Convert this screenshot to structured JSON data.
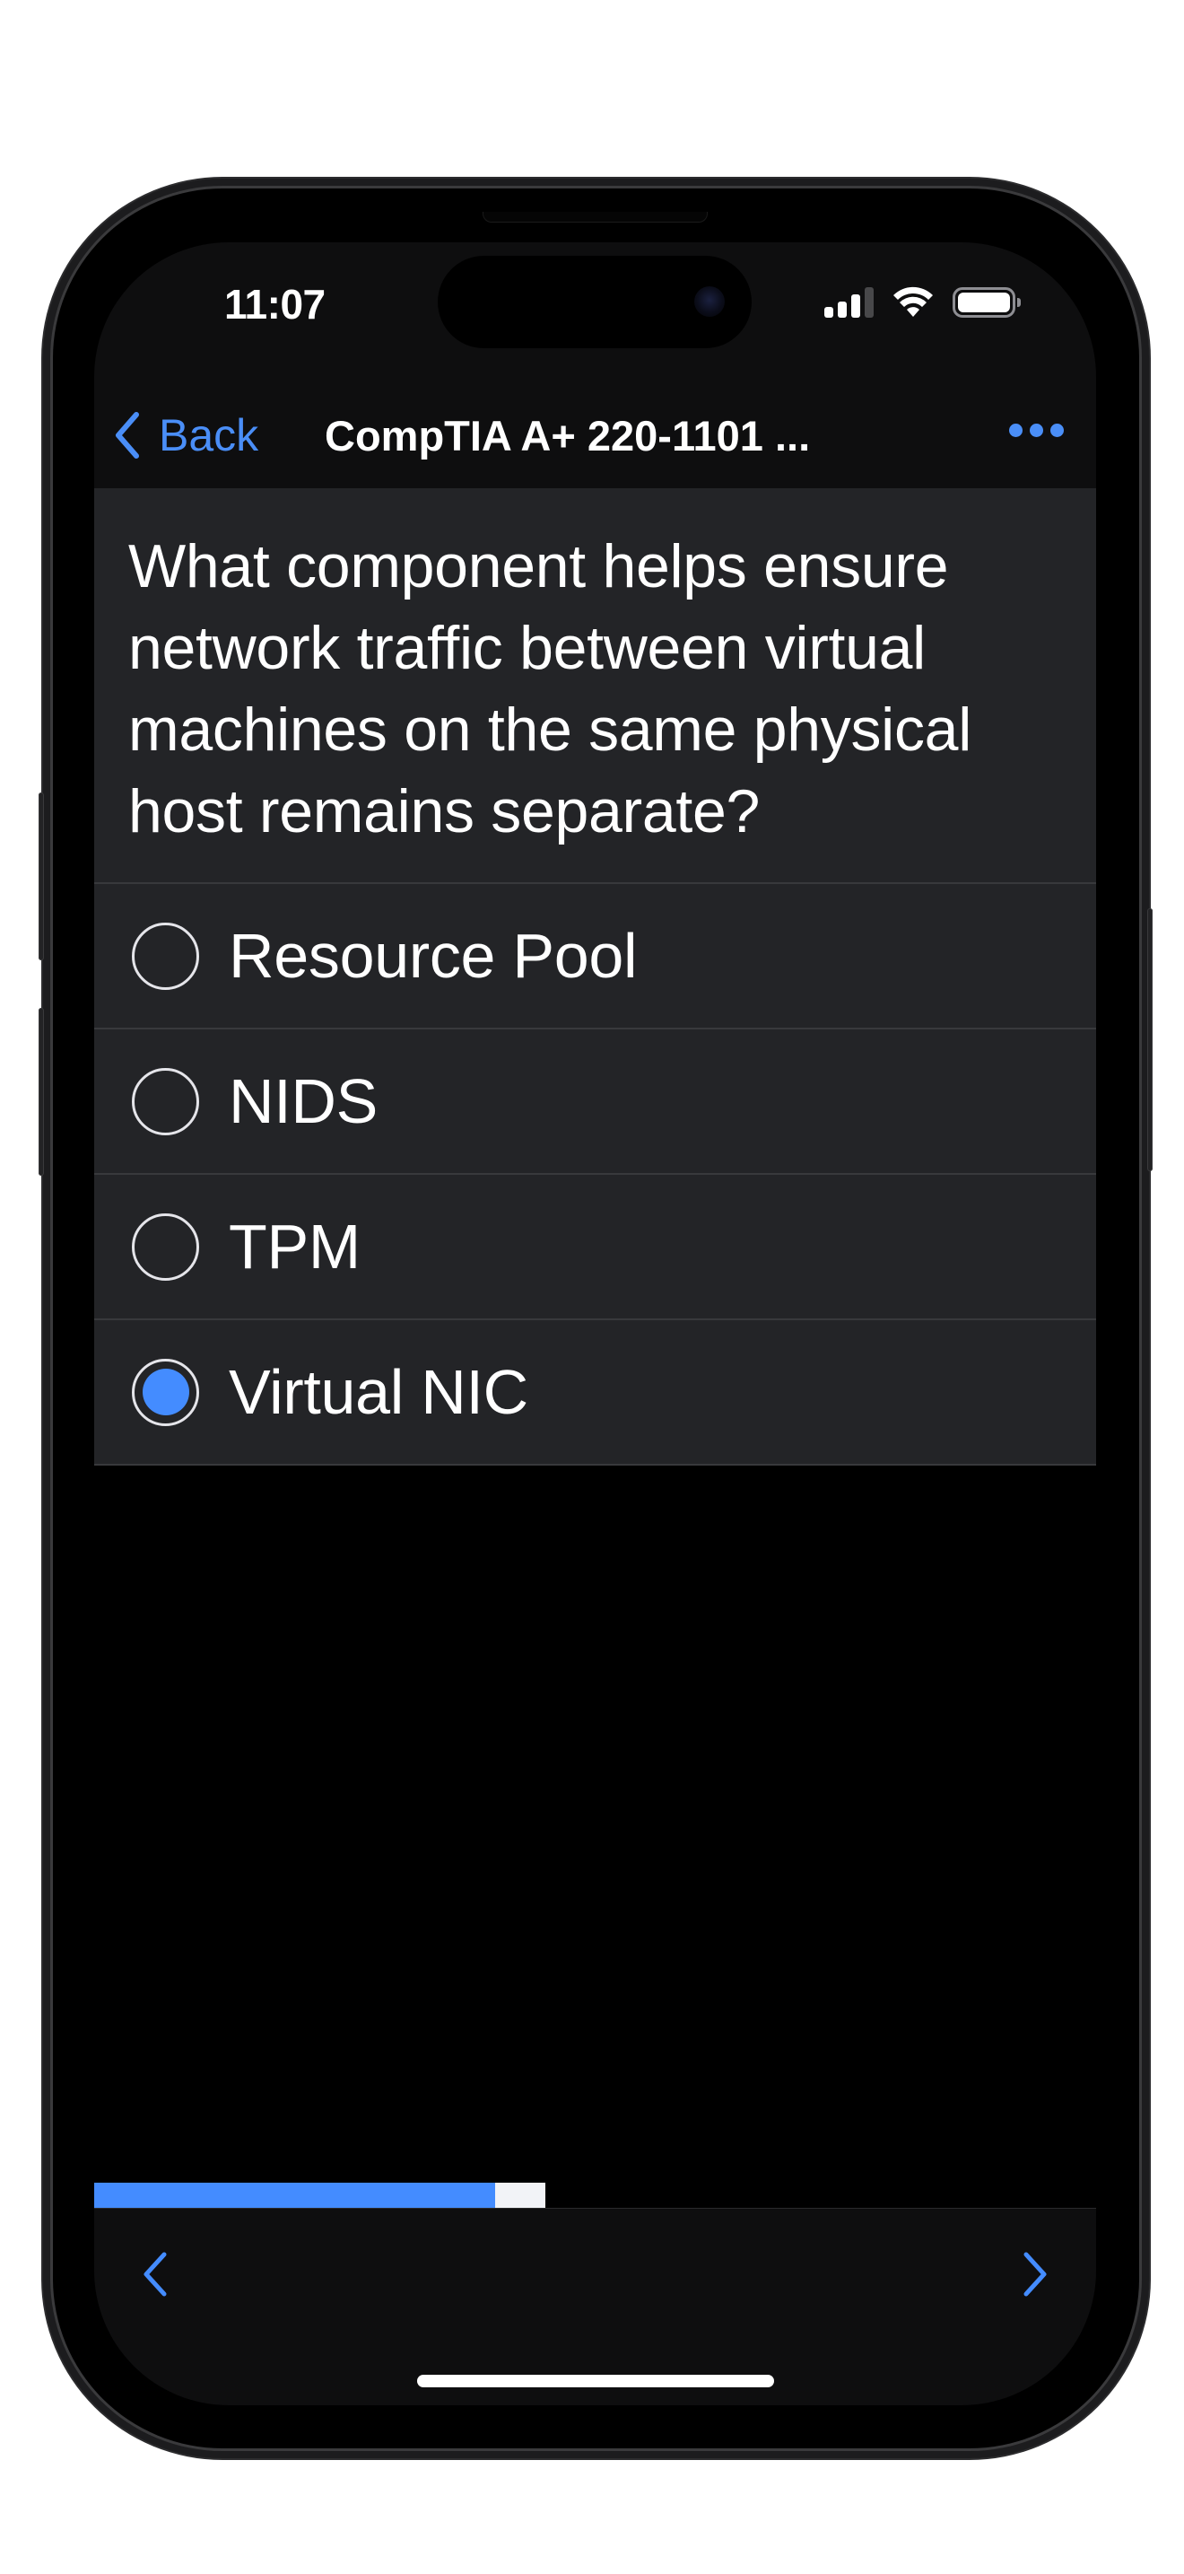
{
  "status_bar": {
    "time": "11:07",
    "signal_bars_active": 3,
    "signal_bars_total": 4,
    "wifi": "wifi-icon",
    "battery": "battery-full-icon"
  },
  "nav": {
    "back_label": "Back",
    "back_icon": "chevron-left-icon",
    "title": "CompTIA A+ 220-1101 ...",
    "more_icon": "ellipsis-icon"
  },
  "question": {
    "text": "What component helps ensure network traffic between virtual machines on the same physical host remains separate?"
  },
  "options": [
    {
      "label": "Resource Pool",
      "selected": false
    },
    {
      "label": "NIDS",
      "selected": false
    },
    {
      "label": "TPM",
      "selected": false
    },
    {
      "label": "Virtual NIC",
      "selected": true
    }
  ],
  "progress": {
    "answered_fraction": 0.4,
    "current_fraction": 0.05
  },
  "toolbar": {
    "prev_icon": "chevron-left-icon",
    "next_icon": "chevron-right-icon"
  },
  "colors": {
    "accent": "#448cff",
    "nav_link": "#4a8ef7",
    "card_bg": "#232427",
    "bar_bg": "#0e0e0f",
    "progress_current": "#f2f3f7"
  }
}
